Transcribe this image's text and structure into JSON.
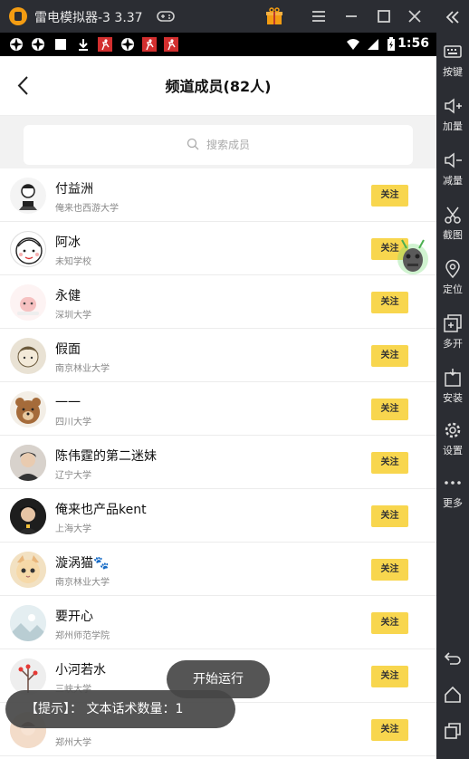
{
  "window": {
    "title": "雷电模拟器-3 3.37"
  },
  "statusbar": {
    "time": "1:56"
  },
  "header": {
    "title": "频道成员(82人)"
  },
  "search": {
    "placeholder": "搜索成员"
  },
  "members": [
    {
      "name": "付益洲",
      "school": "俺来也西游大学",
      "action": "关注"
    },
    {
      "name": "阿冰",
      "school": "未知学校",
      "action": "关注"
    },
    {
      "name": "永健",
      "school": "深圳大学",
      "action": "关注"
    },
    {
      "name": "假面",
      "school": "南京林业大学",
      "action": "关注"
    },
    {
      "name": "一一",
      "school": "四川大学",
      "action": "关注"
    },
    {
      "name": "陈伟霆的第二迷妹",
      "school": "辽宁大学",
      "action": "关注"
    },
    {
      "name": "俺来也产品kent",
      "school": "上海大学",
      "action": "关注"
    },
    {
      "name": "漩涡猫🐾",
      "school": "南京林业大学",
      "action": "关注"
    },
    {
      "name": "要开心",
      "school": "郑州师范学院",
      "action": "关注"
    },
    {
      "name": "小河若水",
      "school": "三峡大学",
      "action": "关注"
    },
    {
      "name": "",
      "school": "郑州大学",
      "action": "关注"
    }
  ],
  "toasts": {
    "run": "开始运行",
    "tip": "【提示】： 文本话术数量：1"
  },
  "sidebar": {
    "items": [
      {
        "label": "按键",
        "icon": "keyboard-icon"
      },
      {
        "label": "加量",
        "icon": "volume-up-icon"
      },
      {
        "label": "减量",
        "icon": "volume-down-icon"
      },
      {
        "label": "截图",
        "icon": "scissors-icon"
      },
      {
        "label": "定位",
        "icon": "location-icon"
      },
      {
        "label": "多开",
        "icon": "multi-window-icon"
      },
      {
        "label": "安装",
        "icon": "apk-install-icon"
      },
      {
        "label": "设置",
        "icon": "gear-icon"
      },
      {
        "label": "更多",
        "icon": "more-icon"
      }
    ]
  },
  "colors": {
    "follow_button": "#f8d64e",
    "chrome": "#2b2d33"
  }
}
